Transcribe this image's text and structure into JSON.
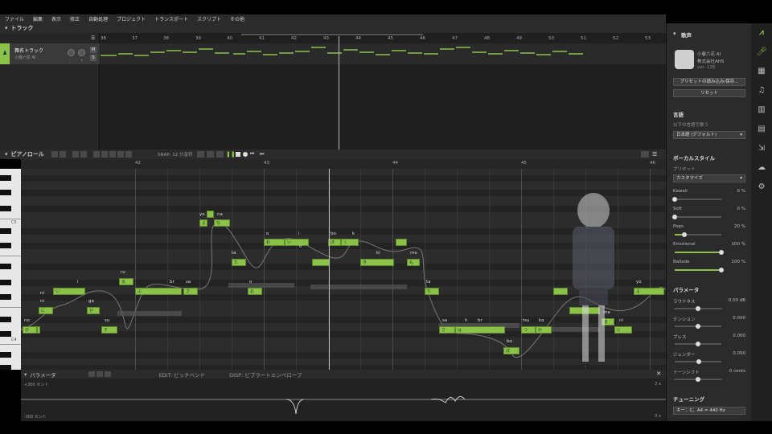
{
  "menu": [
    "ファイル",
    "編集",
    "表示",
    "修正",
    "自動処理",
    "プロジェクト",
    "トランスポート",
    "スクリプト",
    "その他"
  ],
  "track_panel": {
    "title": "トラック",
    "track_name": "舞名トラック",
    "singer": "小春六花 AI",
    "knob_labels": [
      "-",
      "+"
    ],
    "mute": "M",
    "solo": "S",
    "measures": [
      "36",
      "37",
      "38",
      "39",
      "40",
      "41",
      "42",
      "43",
      "44",
      "45",
      "46",
      "47",
      "48",
      "49",
      "50",
      "51",
      "52",
      "53"
    ]
  },
  "piano_roll": {
    "title": "ピアノロール",
    "snap_label": "SNAP: 12 分音符",
    "measures": [
      "42",
      "43",
      "44",
      "45",
      "46"
    ],
    "key_labels": [
      "C5",
      "C4"
    ],
    "lyrics": [
      {
        "t": "yo"
      },
      {
        "t": "na"
      },
      {
        "t": "o"
      },
      {
        "t": "i"
      },
      {
        "t": "bo"
      },
      {
        "t": "k"
      },
      {
        "t": "ru"
      },
      {
        "t": "ta"
      },
      {
        "t": "o"
      },
      {
        "t": "ki"
      },
      {
        "t": "mo"
      },
      {
        "t": "ni"
      },
      {
        "t": "i"
      },
      {
        "t": "br"
      },
      {
        "t": "sa"
      },
      {
        "t": "no"
      },
      {
        "t": "ni"
      },
      {
        "t": "ga"
      },
      {
        "t": "su"
      },
      {
        "t": "o"
      },
      {
        "t": "ta"
      },
      {
        "t": "sa"
      },
      {
        "t": "h"
      },
      {
        "t": "br"
      },
      {
        "t": "tsu"
      },
      {
        "t": "ka"
      },
      {
        "t": "bo"
      },
      {
        "t": "ma"
      },
      {
        "t": "ni"
      },
      {
        "t": "yo"
      }
    ],
    "notes": [
      {
        "t": "よ"
      },
      {
        "t": "な"
      },
      {
        "t": "お"
      },
      {
        "t": "い"
      },
      {
        "t": "ぼ"
      },
      {
        "t": "く"
      },
      {
        "t": "る"
      },
      {
        "t": "た"
      },
      {
        "t": "お"
      },
      {
        "t": "き"
      },
      {
        "t": "も"
      },
      {
        "t": "に"
      },
      {
        "t": "い"
      },
      {
        "t": "ぶ"
      },
      {
        "t": "さ"
      },
      {
        "t": "の"
      },
      {
        "t": "に"
      },
      {
        "t": "が"
      },
      {
        "t": "す"
      },
      {
        "t": "お"
      },
      {
        "t": "た"
      },
      {
        "t": "さ"
      },
      {
        "t": "は"
      },
      {
        "t": "ぶ"
      },
      {
        "t": "つ"
      },
      {
        "t": "か"
      },
      {
        "t": "ぼ"
      },
      {
        "t": "ま"
      },
      {
        "t": "に"
      },
      {
        "t": "よ"
      }
    ]
  },
  "parameters": {
    "title": "パラメータ",
    "edit_label": "EDIT: ピッチベンド",
    "disp_label": "DISP: ビブラートエンベロープ",
    "top_value": "+300 セント",
    "bottom_value": "-300 セント",
    "right_top": "2 x",
    "right_bottom": "0 x"
  },
  "right_panel": {
    "section_singer": "歌声",
    "singer_name": "小春六花 AI",
    "company": "株式会社AHS",
    "version": "ver. 126",
    "preset_button": "プリセットの読み込み/保存...",
    "reset_button": "リセット",
    "language_title": "言語",
    "language_sub": "以下の言語で歌う",
    "language_value": "日本語 (デフォルト)",
    "vocal_style_title": "ボーカルスタイル",
    "preset_label": "プリセット",
    "preset_value": "カスタマイズ",
    "styles": [
      {
        "name": "Kawaii",
        "value": "0 %",
        "level": 0
      },
      {
        "name": "Soft",
        "value": "0 %",
        "level": 0
      },
      {
        "name": "Pops",
        "value": "20 %",
        "level": 0.2
      },
      {
        "name": "Emotional",
        "value": "100 %",
        "level": 1.0
      },
      {
        "name": "Ballade",
        "value": "100 %",
        "level": 1.0
      }
    ],
    "param_title": "パラメータ",
    "params": [
      {
        "name": "ラウドネス",
        "value": "0.00 dB",
        "level": 0.5
      },
      {
        "name": "テンション",
        "value": "0.000",
        "level": 0.5
      },
      {
        "name": "ブレス",
        "value": "0.000",
        "level": 0.5
      },
      {
        "name": "ジェンダー",
        "value": "0.050",
        "level": 0.52
      },
      {
        "name": "トーンシフト",
        "value": "0 cents",
        "level": 0.5
      }
    ],
    "tuning_title": "チューニング",
    "tuning_value": "キー：C、A4 = 440 Hz"
  },
  "side_icons": [
    "logo-icon",
    "mic-icon",
    "film-icon",
    "music-icon",
    "library-icon",
    "book-icon",
    "export-icon",
    "cloud-icon",
    "gear-icon"
  ],
  "colors": {
    "accent": "#8bc34a",
    "background": "#2b2b2b"
  }
}
